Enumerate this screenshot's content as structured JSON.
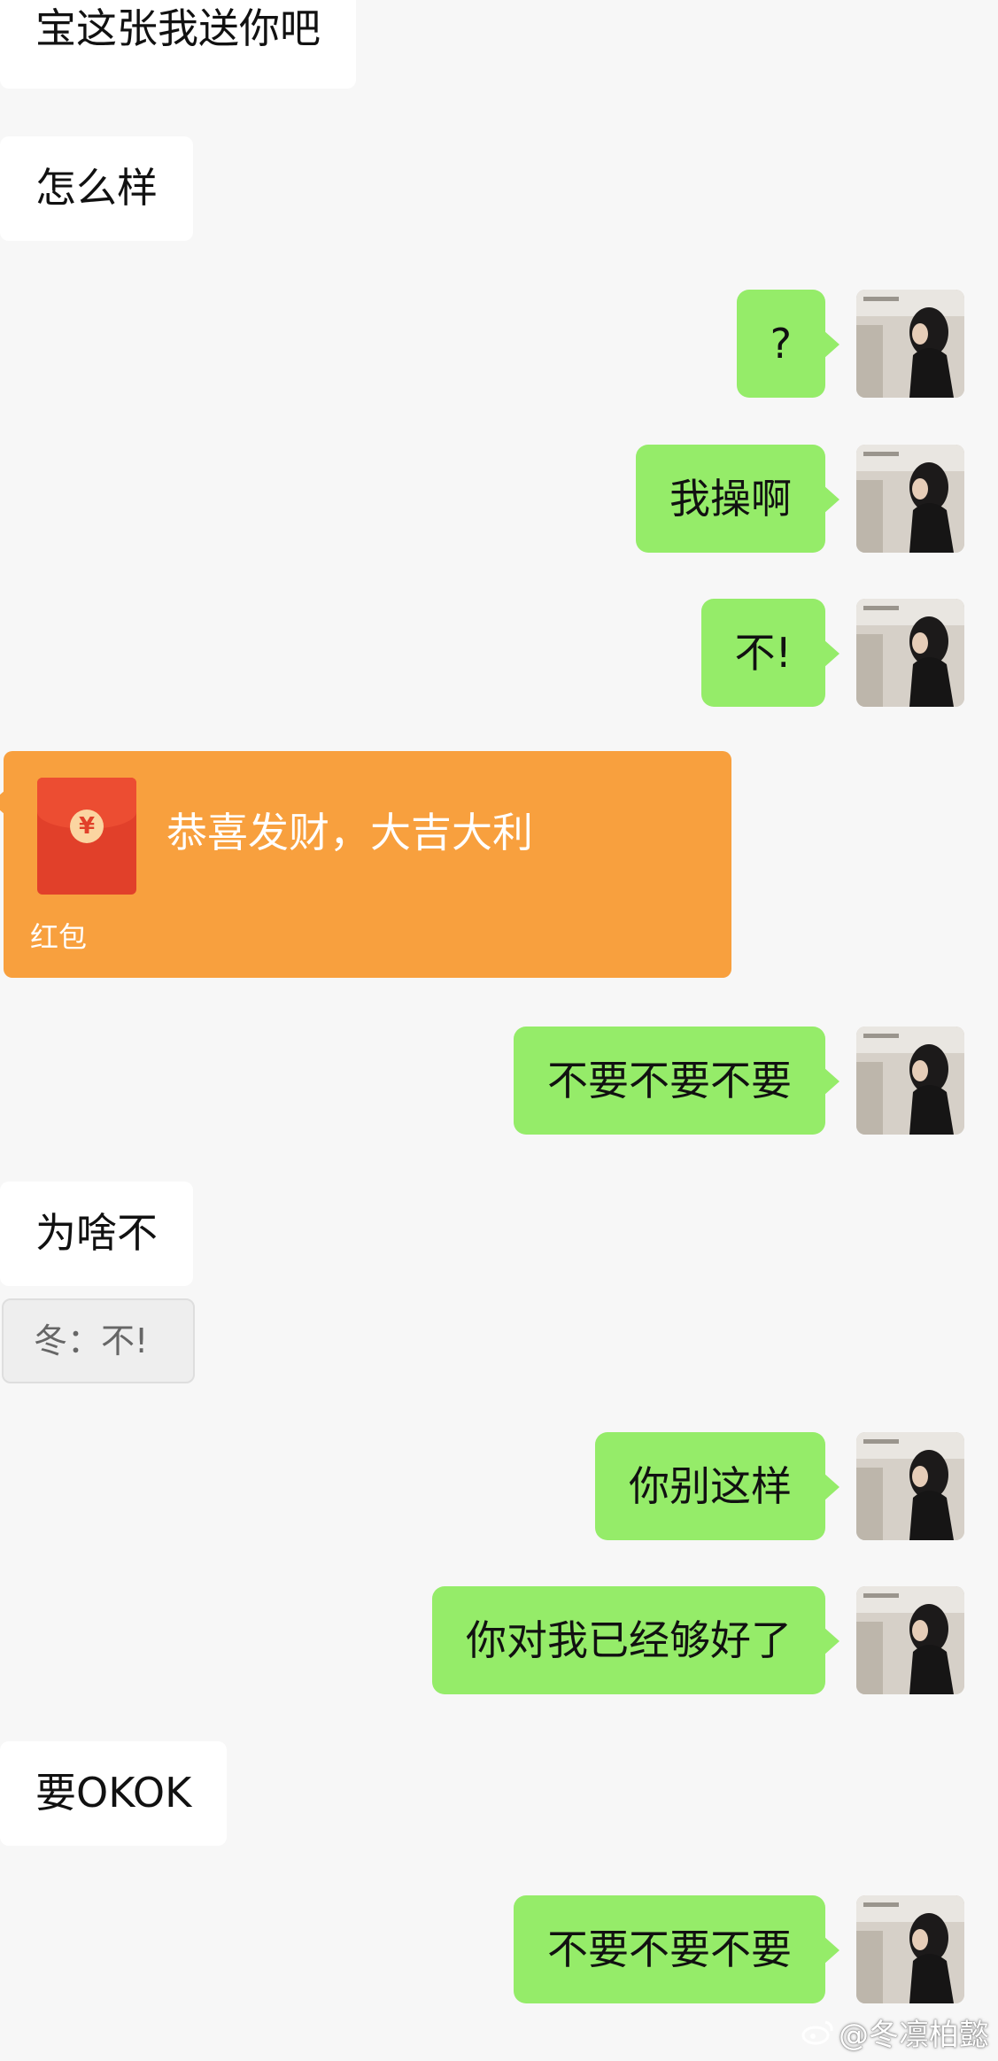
{
  "messages": [
    {
      "side": "in",
      "text": "宝这张我送你吧"
    },
    {
      "side": "in",
      "text": "怎么样"
    },
    {
      "side": "out",
      "text": "?"
    },
    {
      "side": "out",
      "text": "我操啊"
    },
    {
      "side": "out",
      "text": "不!"
    },
    {
      "side": "in",
      "type": "red_packet",
      "title": "恭喜发财，大吉大利",
      "label": "红包"
    },
    {
      "side": "out",
      "text": "不要不要不要"
    },
    {
      "side": "in",
      "text": "为啥不"
    },
    {
      "side": "quote",
      "text": "冬：不!"
    },
    {
      "side": "out",
      "text": "你别这样"
    },
    {
      "side": "out",
      "text": "你对我已经够好了"
    },
    {
      "side": "in",
      "text": "要OKOK"
    },
    {
      "side": "out",
      "text": "不要不要不要"
    }
  ],
  "red_packet": {
    "title": "恭喜发财，大吉大利",
    "label": "红包",
    "currency_symbol": "¥"
  },
  "watermark": "@冬凛柏懿",
  "colors": {
    "background": "#f7f7f7",
    "incoming_bubble": "#ffffff",
    "outgoing_bubble": "#95ec69",
    "red_packet": "#f8a03e",
    "red_packet_icon": "#e1402a"
  }
}
